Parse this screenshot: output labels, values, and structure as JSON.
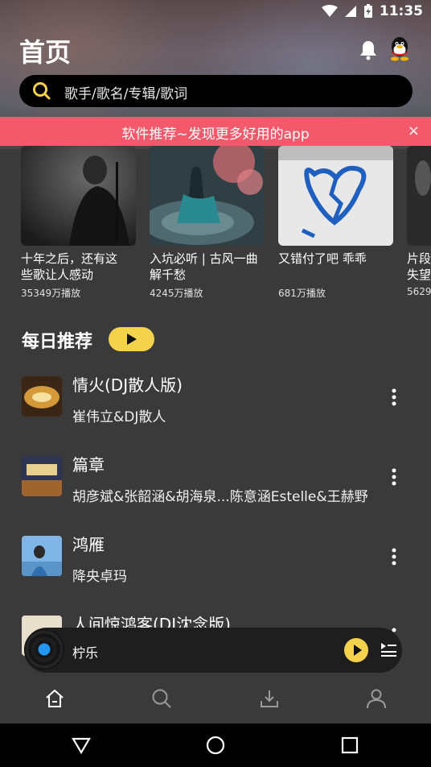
{
  "status": {
    "time": "11:35"
  },
  "header": {
    "title": "首页"
  },
  "search": {
    "placeholder": "歌手/歌名/专辑/歌词"
  },
  "banner": {
    "text": "软件推荐~发现更多好用的app",
    "close": "×"
  },
  "playlists": [
    {
      "title": "十年之后，还有这\n些歌让人感动",
      "plays": "35349万播放"
    },
    {
      "title": "入坑必听 | 古风一曲\n解千愁",
      "plays": "4245万播放"
    },
    {
      "title": "又错付了吧 乖乖",
      "plays": "681万播放"
    },
    {
      "title": "片段\n失望",
      "plays": "5629"
    }
  ],
  "daily": {
    "title": "每日推荐",
    "songs": [
      {
        "name": "情火(DJ散人版)",
        "artist": "崔伟立&DJ散人"
      },
      {
        "name": "篇章",
        "artist": "胡彦斌&张韶涵&胡海泉...陈意涵Estelle&王赫野"
      },
      {
        "name": "鸿雁",
        "artist": "降央卓玛"
      },
      {
        "name": "人间惊鸿客(DJ沈念版)",
        "artist": ""
      }
    ]
  },
  "player": {
    "title": "柠乐"
  },
  "colors": {
    "accent": "#f5d24b",
    "banner": "#f25a6b",
    "background": "#3a3a3a"
  }
}
